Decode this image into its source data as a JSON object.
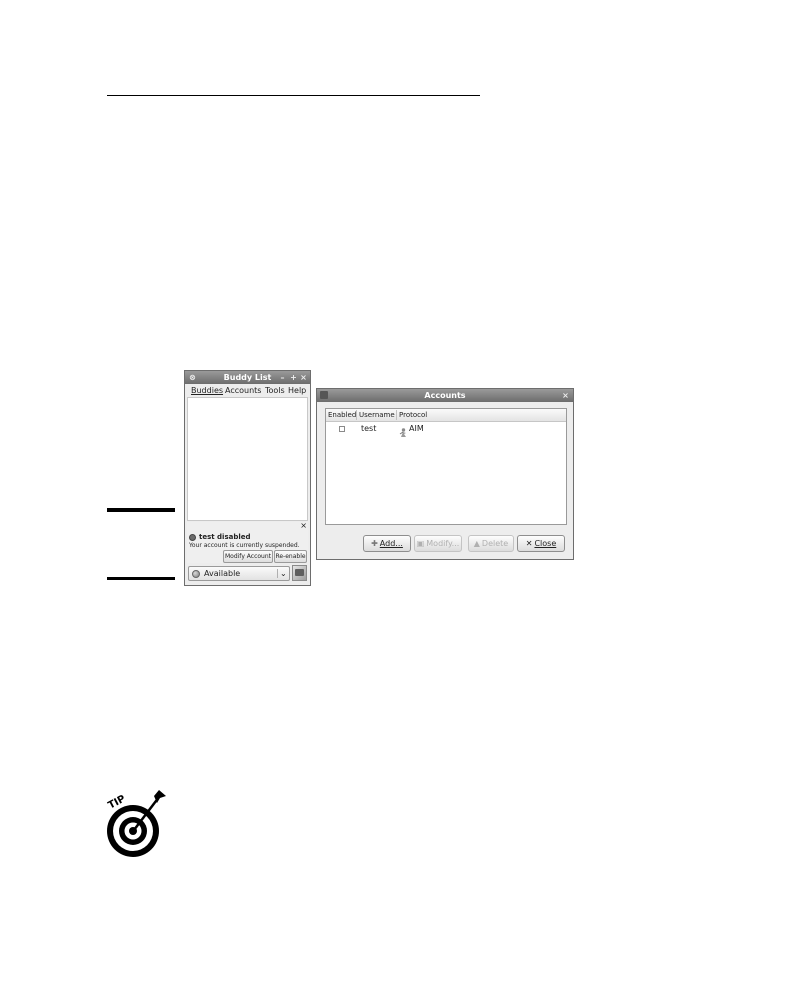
{
  "buddy_list": {
    "title": "Buddy List",
    "menu": [
      "Buddies",
      "Accounts",
      "Tools",
      "Help"
    ],
    "notice": {
      "title": "test disabled",
      "message": "Your account is currently suspended.",
      "modify_label": "Modify Account",
      "reenable_label": "Re-enable",
      "close_glyph": "×"
    },
    "status": {
      "value": "Available",
      "icon": "status-available-icon"
    }
  },
  "accounts": {
    "title": "Accounts",
    "columns": [
      "Enabled",
      "Username",
      "Protocol"
    ],
    "rows": [
      {
        "enabled": false,
        "username": "test",
        "protocol": "AIM"
      }
    ],
    "buttons": {
      "add": "Add...",
      "modify": "Modify...",
      "delete": "Delete",
      "close": "Close"
    }
  }
}
